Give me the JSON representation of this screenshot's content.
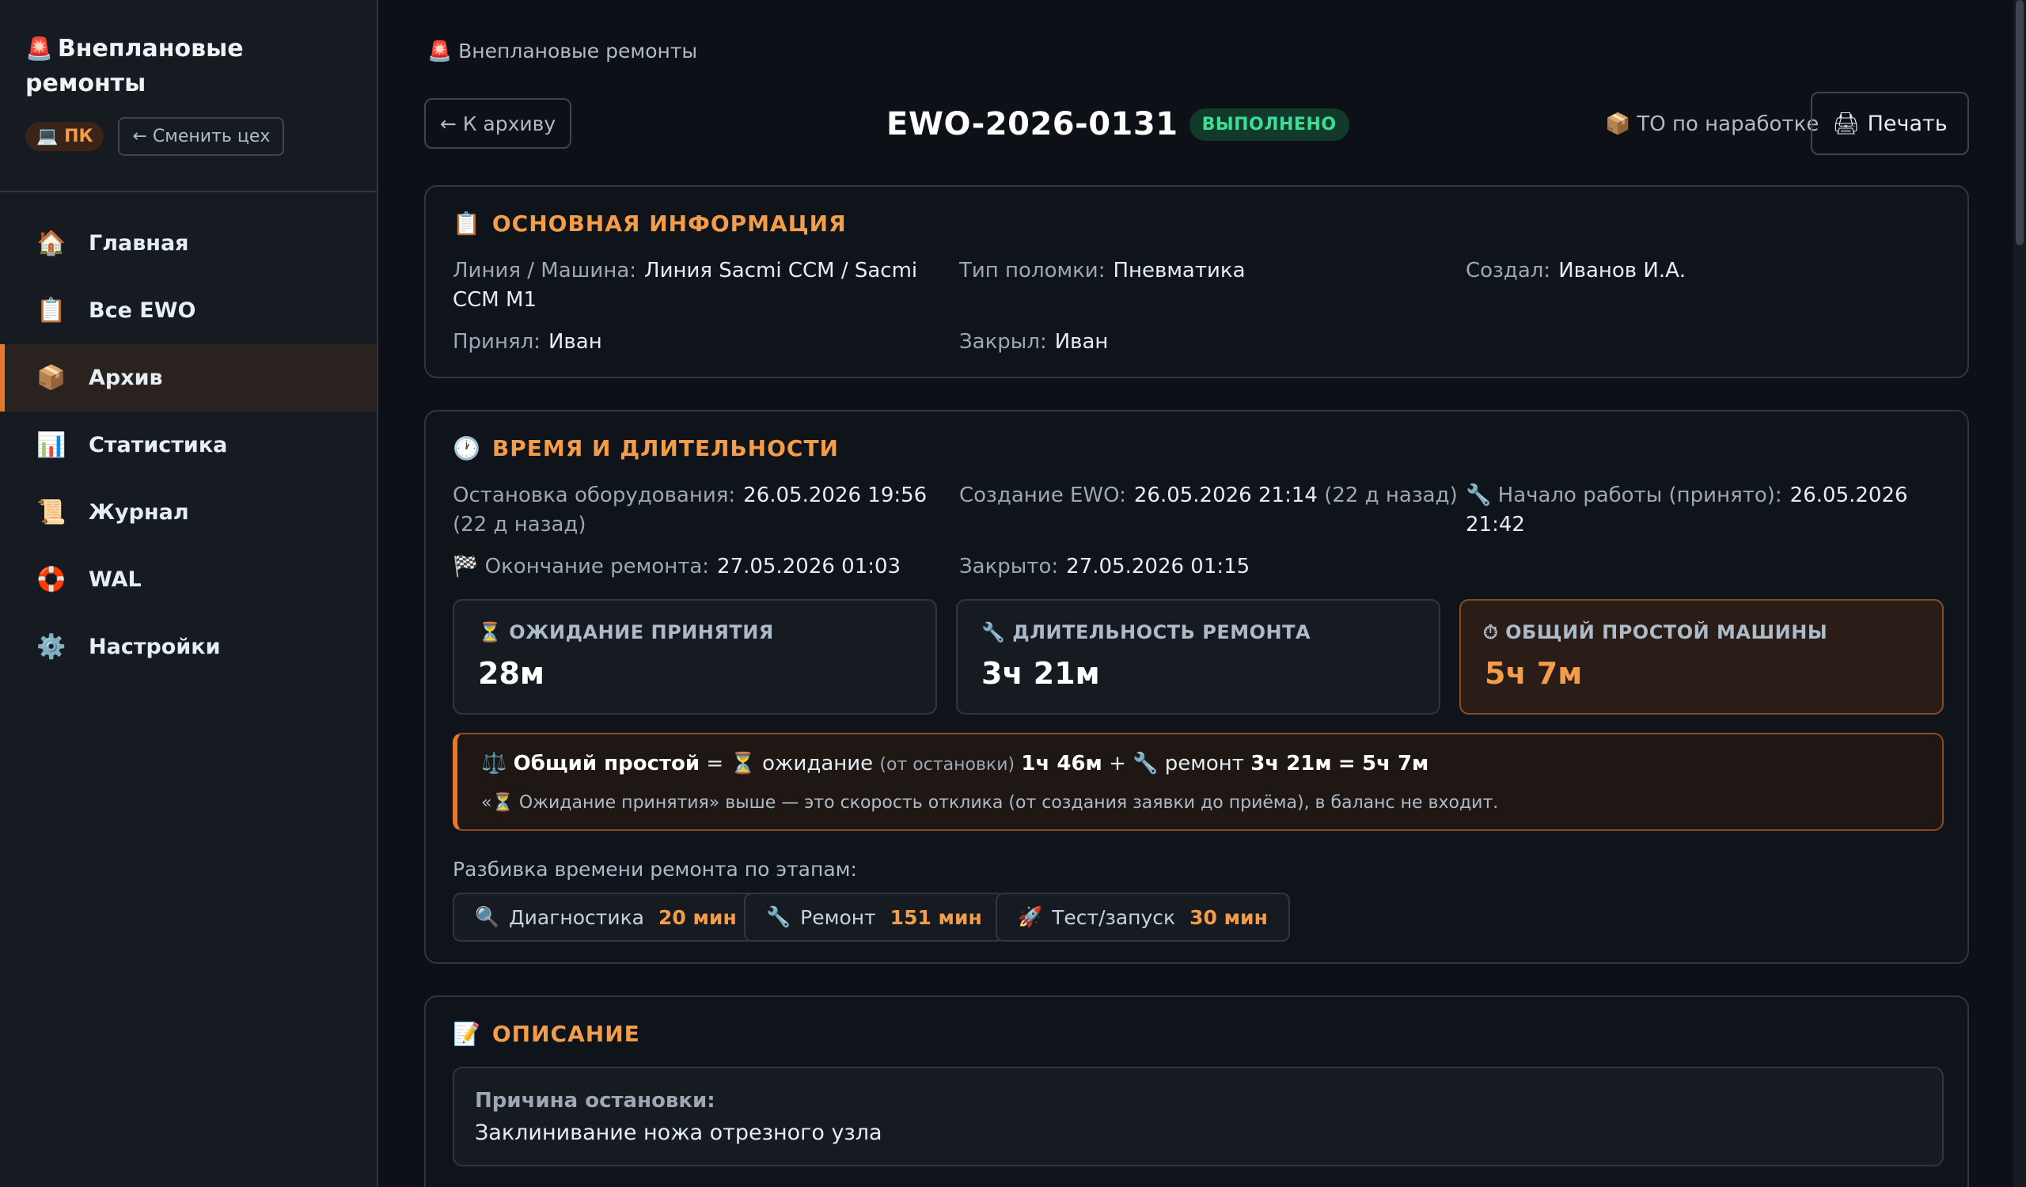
{
  "sidebar": {
    "title_icon": "🚨",
    "title_line1": "Внеплановые",
    "title_line2": "ремонты",
    "chip_icon": "💻",
    "chip_label": "ПК",
    "switch_label": "← Сменить цех",
    "items": [
      {
        "icon": "🏠",
        "label": "Главная"
      },
      {
        "icon": "📋",
        "label": "Все EWO"
      },
      {
        "icon": "📦",
        "label": "Архив"
      },
      {
        "icon": "📊",
        "label": "Статистика"
      },
      {
        "icon": "📜",
        "label": "Журнал"
      },
      {
        "icon": "🛟",
        "label": "WAL"
      },
      {
        "icon": "⚙️",
        "label": "Настройки"
      }
    ],
    "active_index": 2
  },
  "header": {
    "breadcrumb_icon": "🚨",
    "breadcrumb": "Внеплановые ремонты",
    "back_label": "← К архиву",
    "ewo_id": "EWO-2026-0131",
    "status": "ВЫПОЛНЕНО",
    "to_icon": "📦",
    "to_label": "ТО по наработке",
    "print_icon": "🖨",
    "print_label": "Печать"
  },
  "basic": {
    "icon": "📋",
    "title": "ОСНОВНАЯ ИНФОРМАЦИЯ",
    "line_label": "Линия / Машина:",
    "line_value_1": "Линия Sacmi CCM / Sacmi",
    "line_value_2": "CCM M1",
    "type_label": "Тип поломки:",
    "type_value": "Пневматика",
    "created_label": "Создал:",
    "created_value": "Иванов И.А.",
    "accepted_label": "Принял:",
    "accepted_value": "Иван",
    "closed_label": "Закрыл:",
    "closed_value": "Иван"
  },
  "timing": {
    "icon": "🕐",
    "title": "ВРЕМЯ И ДЛИТЕЛЬНОСТИ",
    "stop_label": "Остановка оборудования:",
    "stop_value": "26.05.2026 19:56",
    "stop_ago": "(22 д назад)",
    "create_label": "Создание EWO:",
    "create_value": "26.05.2026 21:14",
    "create_ago": "(22 д назад)",
    "start_icon": "🔧",
    "start_label": "Начало работы (принято):",
    "start_value_1": "26.05.2026",
    "start_value_2": "21:42",
    "end_icon": "🏁",
    "end_label": "Окончание ремонта:",
    "end_value": "27.05.2026 01:03",
    "closed_label": "Закрыто:",
    "closed_value": "27.05.2026 01:15",
    "stats": [
      {
        "icon": "⏳",
        "label": "ОЖИДАНИЕ ПРИНЯТИЯ",
        "value": "28м"
      },
      {
        "icon": "🔧",
        "label": "ДЛИТЕЛЬНОСТЬ РЕМОНТА",
        "value": "3ч 21м"
      },
      {
        "icon": "⏱",
        "label": "ОБЩИЙ ПРОСТОЙ МАШИНЫ",
        "value": "5ч 7м"
      }
    ],
    "balance": {
      "icon": "⚖️",
      "total_label": "Общий простой",
      "eq": "=",
      "wait_icon": "⏳",
      "wait_word": "ожидание",
      "wait_note": "(от остановки)",
      "wait_value": "1ч 46м",
      "plus": "+",
      "repair_icon": "🔧",
      "repair_word": "ремонт",
      "repair_value": "3ч 21м",
      "eq2": "=",
      "total_value": "5ч 7м",
      "note": "«⏳ Ожидание принятия» выше — это скорость отклика (от создания заявки до приёма), в баланс не входит."
    },
    "stages_label": "Разбивка времени ремонта по этапам:",
    "stages": [
      {
        "icon": "🔍",
        "label": "Диагностика",
        "value": "20 мин"
      },
      {
        "icon": "🔧",
        "label": "Ремонт",
        "value": "151 мин"
      },
      {
        "icon": "🚀",
        "label": "Тест/запуск",
        "value": "30 мин"
      }
    ]
  },
  "description": {
    "icon": "📝",
    "title": "ОПИСАНИЕ",
    "reason_label": "Причина остановки:",
    "reason_value": "Заклинивание ножа отрезного узла"
  }
}
